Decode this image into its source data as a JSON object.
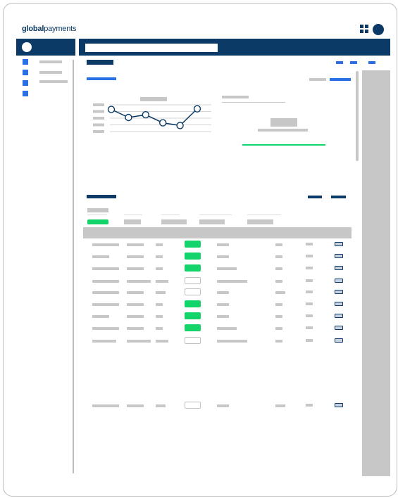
{
  "app": {
    "logo_bold": "global",
    "logo_regular": "payments"
  },
  "icons": {
    "apps": "apps-grid-icon",
    "profile": "user-avatar-icon",
    "action": "action-icon",
    "nav": "nav-item-icon"
  },
  "colors": {
    "navy": "#0b3a66",
    "blue": "#2a6fe6",
    "green": "#12d46a",
    "placeholder_gray": "#c7c7c7"
  },
  "chart_data": {
    "type": "line",
    "x": [
      1,
      2,
      3,
      4,
      5,
      6
    ],
    "values": [
      3.2,
      2.0,
      2.4,
      1.2,
      0.8,
      3.3
    ],
    "ylim": [
      0,
      4
    ],
    "title": "",
    "xlabel": "",
    "ylabel": "",
    "grid": true
  },
  "table": {
    "rows": [
      {
        "status": "green",
        "note_level": 0.12
      },
      {
        "status": "green",
        "note_level": 0.12
      },
      {
        "status": "green",
        "note_level": 0.3
      },
      {
        "status": "outline",
        "note_level": 0.55
      },
      {
        "status": "outline",
        "note_level": 0.12
      },
      {
        "status": "green",
        "note_level": 0.12
      },
      {
        "status": "green",
        "note_level": 0.12
      },
      {
        "status": "green",
        "note_level": 0.3
      },
      {
        "status": "outline",
        "note_level": 0.55
      },
      {
        "status": "outline",
        "note_level": 0.12
      }
    ]
  }
}
